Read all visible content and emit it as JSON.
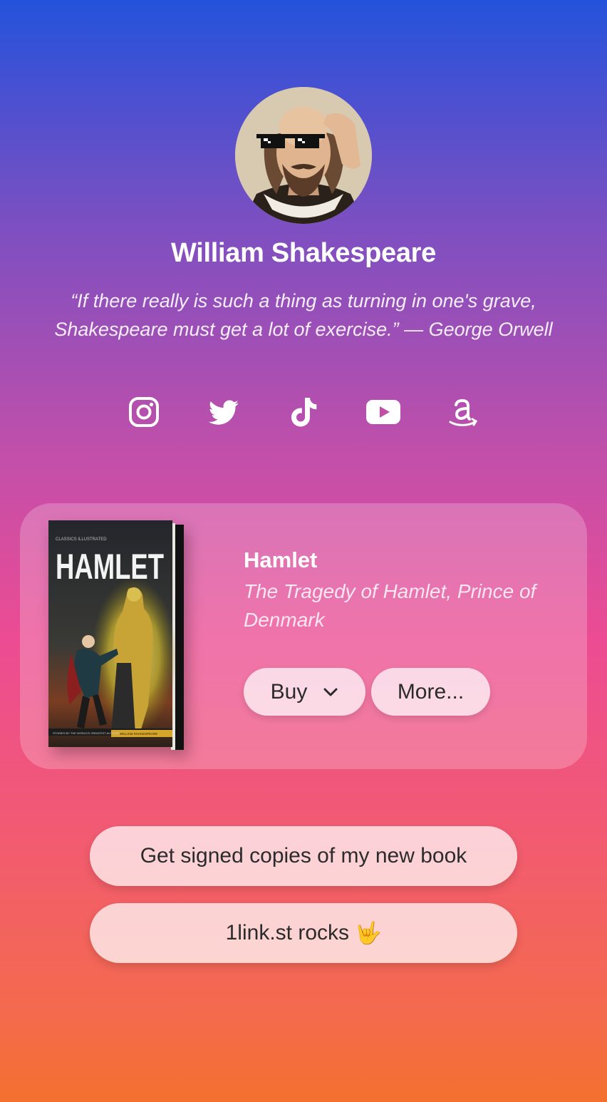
{
  "profile": {
    "name": "William Shakespeare",
    "quote": "“If there really is such a thing as turning in one's grave, Shakespeare must get a lot of exercise.” — George Orwell"
  },
  "socials": [
    {
      "icon": "instagram-icon"
    },
    {
      "icon": "twitter-icon"
    },
    {
      "icon": "tiktok-icon"
    },
    {
      "icon": "youtube-icon"
    },
    {
      "icon": "amazon-icon"
    }
  ],
  "featured": {
    "title": "Hamlet",
    "subtitle": "The Tragedy of Hamlet, Prince of Denmark",
    "cover_title": "HAMLET",
    "buy_label": "Buy",
    "more_label": "More..."
  },
  "links": [
    {
      "label": "Get signed copies of my new book"
    },
    {
      "label": "1link.st rocks",
      "emoji": "🤟"
    }
  ]
}
